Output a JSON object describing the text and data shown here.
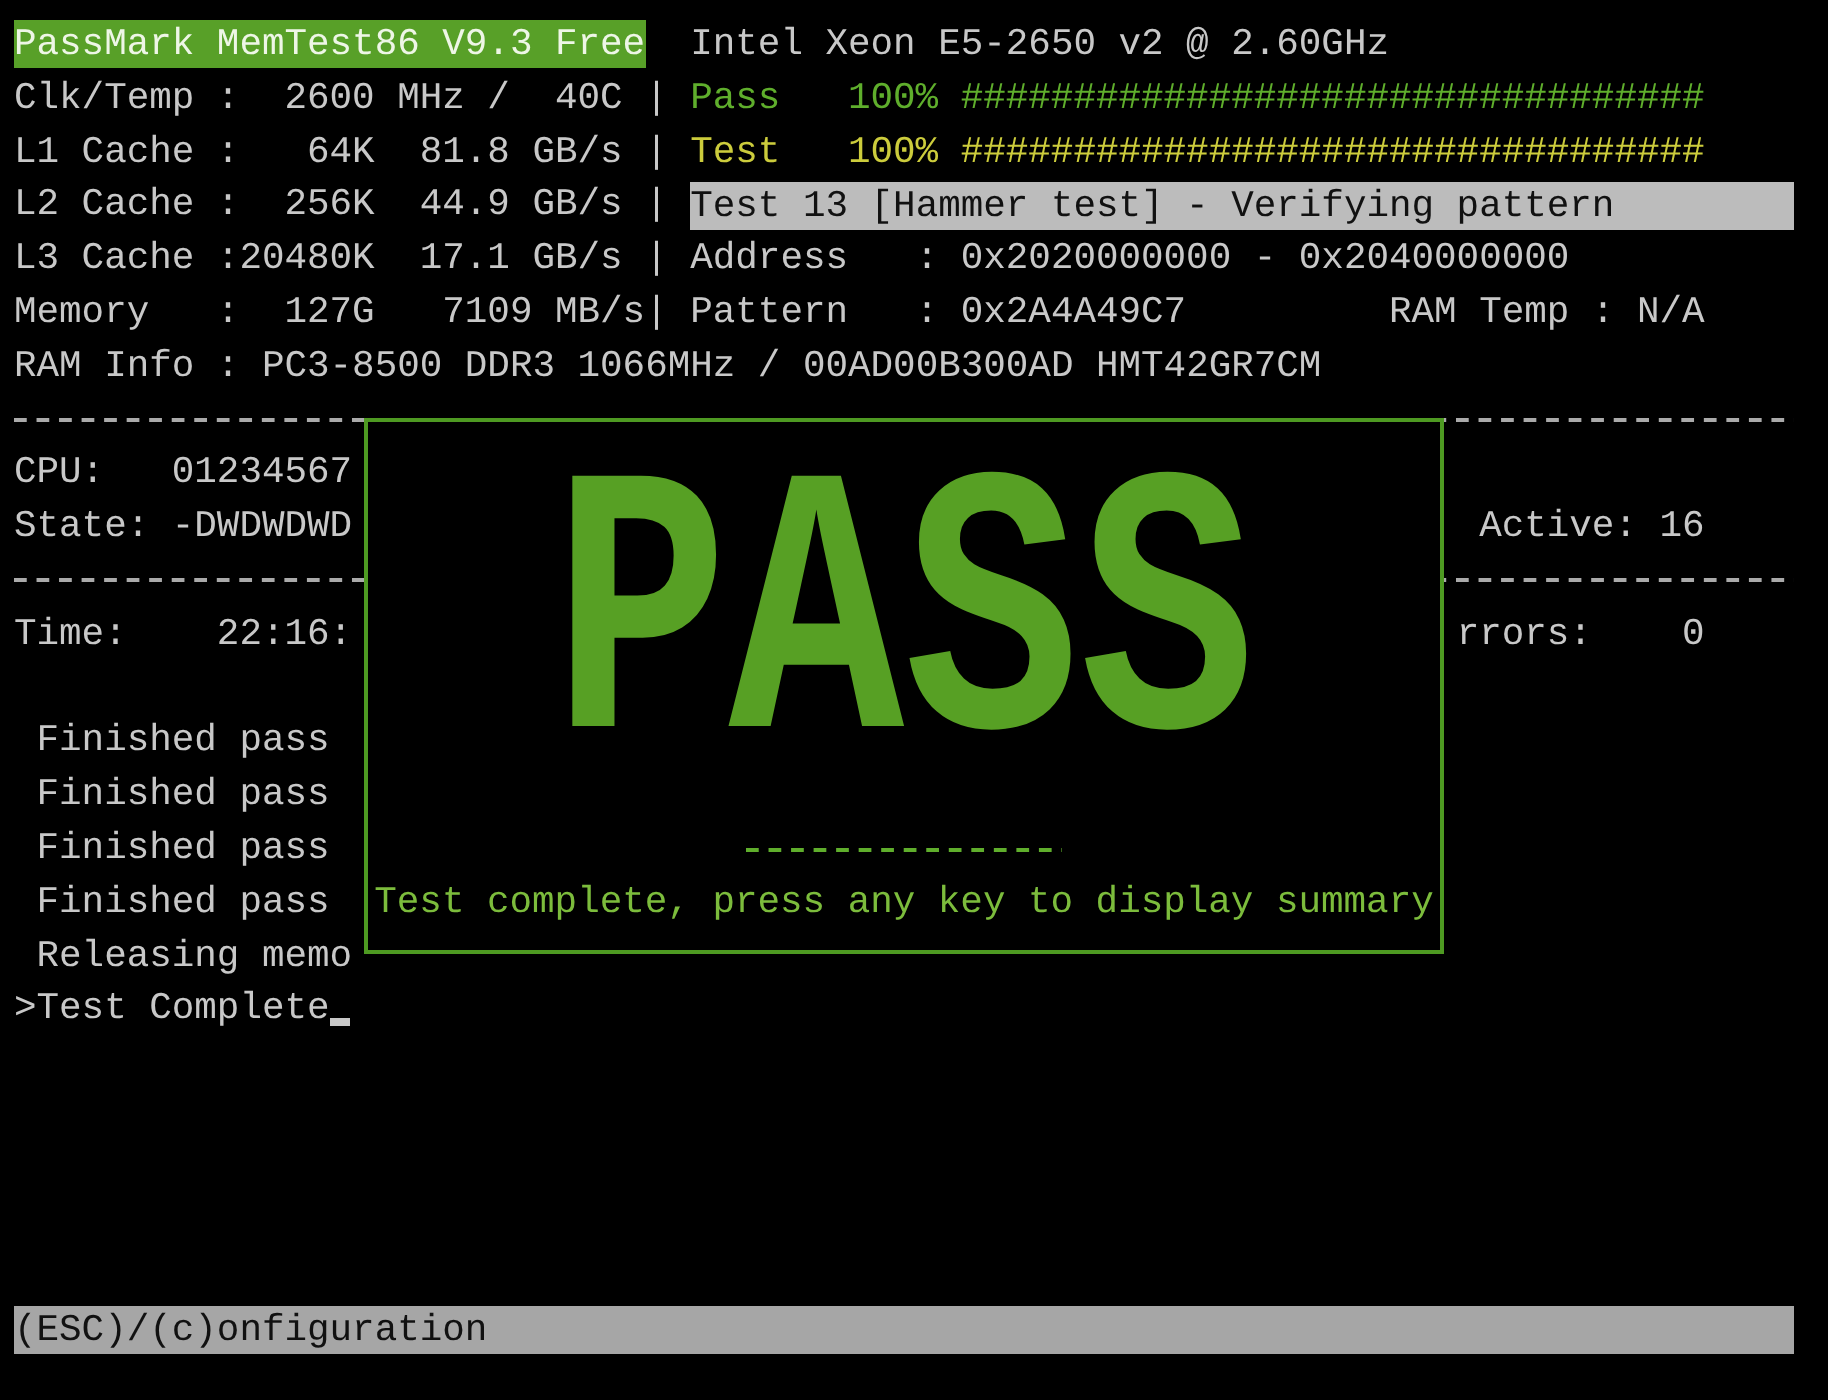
{
  "header": {
    "title": "PassMark MemTest86 V9.3 Free",
    "cpu_model": "Intel Xeon E5-2650 v2 @ 2.60GHz"
  },
  "system_info": [
    "Clk/Temp :  2600 MHz /  40C |",
    "L1 Cache :   64K  81.8 GB/s |",
    "L2 Cache :  256K  44.9 GB/s |",
    "L3 Cache :20480K  17.1 GB/s |",
    "Memory   :  127G   7109 MB/s|"
  ],
  "progress": [
    {
      "kind": "pass",
      "label": "Pass",
      "percent": "100%",
      "bar": "#################################"
    },
    {
      "kind": "test",
      "label": "Test",
      "percent": "100%",
      "bar": "#################################"
    }
  ],
  "current_test": "Test 13 [Hammer test] - Verifying pattern",
  "address_line": "Address   : 0x2020000000 - 0x2040000000",
  "pattern_line": "Pattern   : 0x2A4A49C7",
  "ram_temp": "RAM Temp : N/A",
  "ram_info": "RAM Info : PC3-8500 DDR3 1066MHz / 00AD00B300AD HMT42GR7CM",
  "cpu_status": {
    "cpu_line": "CPU:   01234567",
    "state_line": "State: -DWDWDWD",
    "active": "Active: 16",
    "time": "Time:    22:16:",
    "errors": "rrors:    0"
  },
  "log": [
    " Finished pass",
    " Finished pass",
    " Finished pass",
    " Finished pass",
    " Releasing memo",
    ">Test Complete"
  ],
  "result_dialog": {
    "result": "PASS",
    "message": "Test complete, press any key to display summary"
  },
  "status_bar": "(ESC)/(c)onfiguration"
}
